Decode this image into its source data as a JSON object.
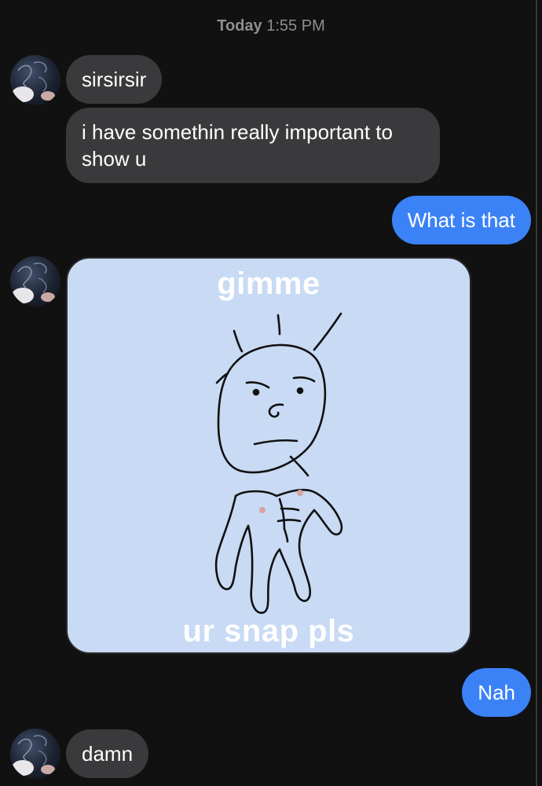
{
  "timestamp": {
    "day": "Today",
    "time": "1:55 PM"
  },
  "messages": [
    {
      "from": "them",
      "text": "sirsirsir"
    },
    {
      "from": "them",
      "text": "i have somethin really important to show u"
    },
    {
      "from": "me",
      "text": "What is that"
    },
    {
      "from": "them",
      "image": {
        "top_text": "gimme",
        "bottom_text": "ur snap pls",
        "background": "#c8daf4",
        "drawing": "stick-figure-drawing"
      }
    },
    {
      "from": "me",
      "text": "Nah"
    },
    {
      "from": "them",
      "text": "damn"
    }
  ],
  "colors": {
    "background": "#111111",
    "incoming_bubble": "#3a3a3c",
    "outgoing_bubble": "#3b82f6",
    "timestamp": "#8e8e93"
  }
}
